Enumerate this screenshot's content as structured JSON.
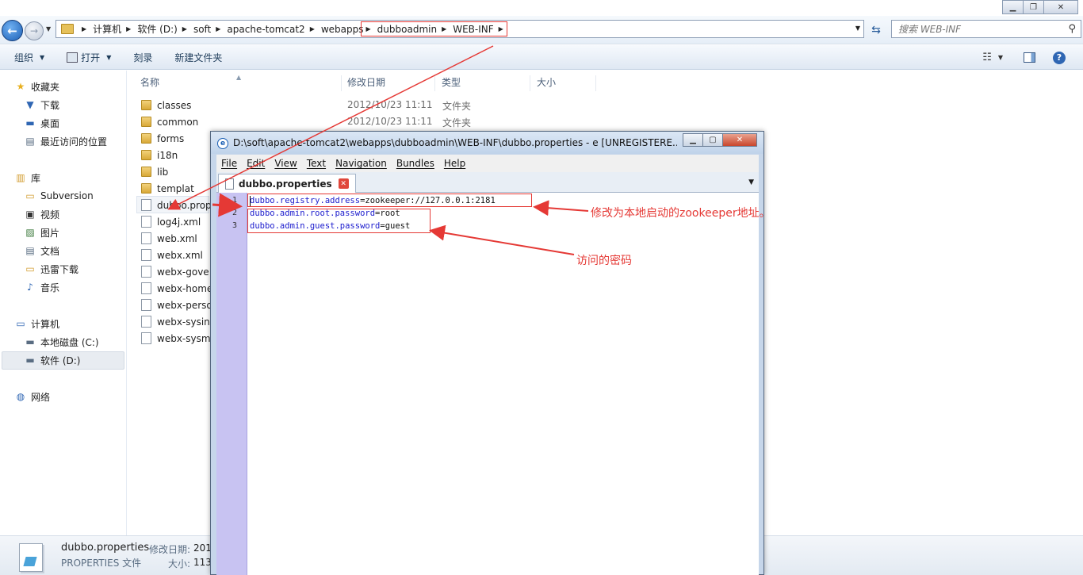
{
  "explorer": {
    "breadcrumbs": [
      "计算机",
      "软件 (D:)",
      "soft",
      "apache-tomcat2",
      "webapps",
      "dubboadmin",
      "WEB-INF"
    ],
    "search_placeholder": "搜索 WEB-INF",
    "toolbar": {
      "organize": "组织",
      "open": "打开",
      "burn": "刻录",
      "new_folder": "新建文件夹"
    },
    "nav": {
      "favorites": "收藏夹",
      "favorites_items": [
        "下载",
        "桌面",
        "最近访问的位置"
      ],
      "libraries": "库",
      "library_items": [
        "Subversion",
        "视频",
        "图片",
        "文档",
        "迅雷下载",
        "音乐"
      ],
      "computer": "计算机",
      "computer_items": [
        "本地磁盘 (C:)",
        "软件 (D:)"
      ],
      "network": "网络"
    },
    "columns": {
      "name": "名称",
      "date": "修改日期",
      "type": "类型",
      "size": "大小"
    },
    "files": [
      {
        "name": "classes",
        "date": "2012/10/23 11:11",
        "type": "文件夹"
      },
      {
        "name": "common",
        "date": "2012/10/23 11:11",
        "type": "文件夹"
      },
      {
        "name": "forms",
        "date": "",
        "type": ""
      },
      {
        "name": "i18n",
        "date": "",
        "type": ""
      },
      {
        "name": "lib",
        "date": "",
        "type": ""
      },
      {
        "name": "templat",
        "date": "",
        "type": ""
      },
      {
        "name": "dubbo.prop",
        "date": "",
        "type": ""
      },
      {
        "name": "log4j.xml",
        "date": "",
        "type": ""
      },
      {
        "name": "web.xml",
        "date": "",
        "type": ""
      },
      {
        "name": "webx.xml",
        "date": "",
        "type": ""
      },
      {
        "name": "webx-gove",
        "date": "",
        "type": ""
      },
      {
        "name": "webx-home",
        "date": "",
        "type": ""
      },
      {
        "name": "webx-perso",
        "date": "",
        "type": ""
      },
      {
        "name": "webx-sysin",
        "date": "",
        "type": ""
      },
      {
        "name": "webx-sysm",
        "date": "",
        "type": ""
      }
    ],
    "status": {
      "file_name": "dubbo.properties",
      "file_type": "PROPERTIES 文件",
      "modified_label": "修改日期:",
      "modified_value": "201",
      "size_label": "大小:",
      "size_value": "113"
    }
  },
  "editor": {
    "title": "D:\\soft\\apache-tomcat2\\webapps\\dubboadmin\\WEB-INF\\dubbo.properties - e  [UNREGISTERE...",
    "menus": [
      "File",
      "Edit",
      "View",
      "Text",
      "Navigation",
      "Bundles",
      "Help"
    ],
    "tab": "dubbo.properties",
    "lines": [
      {
        "num": "1",
        "key": "dubbo.registry.address",
        "eq": "=",
        "value": "zookeeper://127.0.0.1:2181"
      },
      {
        "num": "2",
        "key": "dubbo.admin.root.password",
        "eq": "=",
        "value": "root"
      },
      {
        "num": "3",
        "key": "dubbo.admin.guest.password",
        "eq": "=",
        "value": "guest"
      }
    ]
  },
  "annotations": {
    "zookeeper_note": "修改为本地启动的zookeeper地址。",
    "password_note": "访问的密码",
    "color": "#e53935"
  }
}
